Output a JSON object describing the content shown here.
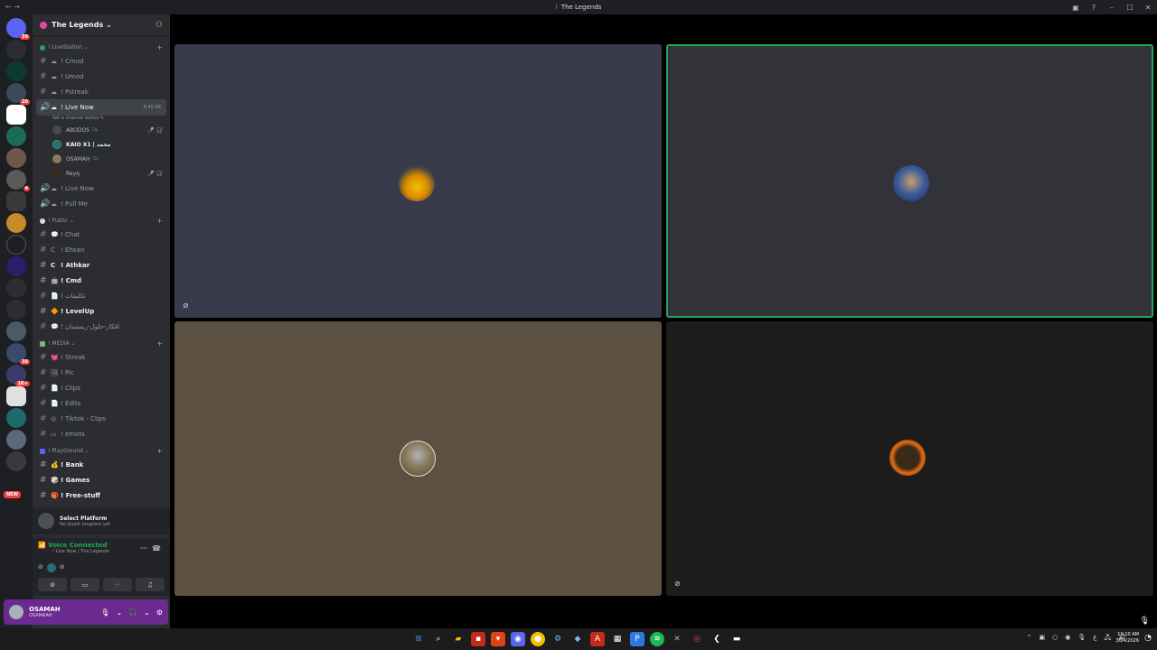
{
  "window": {
    "title": "The Legends",
    "controls": [
      "▣",
      "?",
      "–",
      "☐",
      "✕"
    ]
  },
  "rail": {
    "badges": [
      "39",
      "20",
      "4",
      "38",
      "1K+"
    ],
    "new_label": "NEW"
  },
  "guild": {
    "name": "The Legends ⌄"
  },
  "categories": [
    {
      "name": "! LiveStation ⌄",
      "color": "#23a55a",
      "channels": [
        {
          "icon": "☁",
          "name": "! Cmod"
        },
        {
          "icon": "☁",
          "name": "! Umod"
        },
        {
          "icon": "☁",
          "name": "! Pstreak"
        }
      ]
    }
  ],
  "live": {
    "name": "! Live Now",
    "time": "6:45:06",
    "status": "Set a channel status ✎",
    "users": [
      {
        "name": "ABODOS",
        "tag": "OL"
      },
      {
        "name": "KAIO X1 | محمد",
        "tag": ""
      },
      {
        "name": "OSAMAH",
        "tag": "OL"
      },
      {
        "name": "Reyq",
        "tag": ""
      }
    ]
  },
  "voice_extra": [
    {
      "name": "! Live Now"
    },
    {
      "name": "! Pull Me"
    }
  ],
  "public": {
    "name": "! Public ⌄",
    "channels": [
      {
        "icon": "💬",
        "name": "! Chat",
        "bold": false
      },
      {
        "icon": "C",
        "name": "! Ehsan",
        "bold": false
      },
      {
        "icon": "C",
        "name": "! Athkar",
        "bold": true
      },
      {
        "icon": "🤖",
        "name": "! Cmd",
        "bold": true
      },
      {
        "icon": "📄",
        "name": "! تكليفات",
        "bold": false
      },
      {
        "icon": "🔶",
        "name": "! LevelUp",
        "bold": true
      },
      {
        "icon": "💬",
        "name": "! افكار-حلول-ريمستان",
        "bold": false
      }
    ]
  },
  "media": {
    "name": "! MEDIA ⌄",
    "channels": [
      {
        "icon": "💓",
        "name": "! Streak"
      },
      {
        "icon": "🖼",
        "name": "! Pic"
      },
      {
        "icon": "📄",
        "name": "! Clips"
      },
      {
        "icon": "📄",
        "name": "! Edits"
      },
      {
        "icon": "◎",
        "name": "! Tiktok - Clips"
      },
      {
        "icon": "▭",
        "name": "! emots"
      }
    ]
  },
  "playground": {
    "name": "! PlayGround ⌄",
    "channels": [
      {
        "icon": "💰",
        "name": "! Bank",
        "bold": true
      },
      {
        "icon": "🎲",
        "name": "! Games",
        "bold": true
      },
      {
        "icon": "🎁",
        "name": "! Free-stuff",
        "bold": true
      }
    ]
  },
  "quest": {
    "title": "Select Platform",
    "subtitle": "No Quest progress yet"
  },
  "voice_panel": {
    "title": "Voice Connected",
    "subtitle": "! Live Now / The Legends"
  },
  "user": {
    "name": "OSAMAH",
    "status": "OSAMAAH"
  },
  "taskbar": {
    "time": "10:10 AM",
    "date": "3/24/2026"
  }
}
